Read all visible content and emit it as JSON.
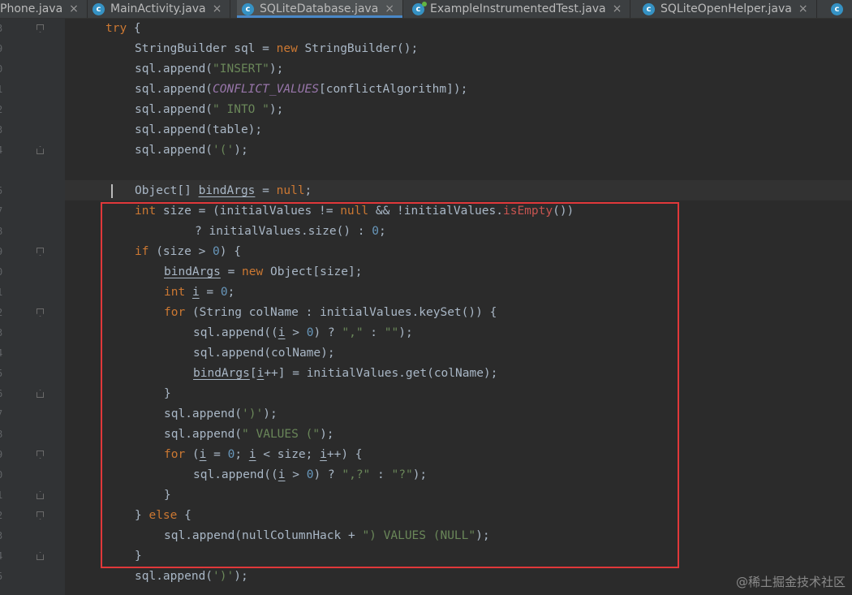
{
  "tabs": [
    {
      "label": "Phone.java",
      "icon": "none",
      "active": false
    },
    {
      "label": "MainActivity.java",
      "icon": "class-icon",
      "active": false
    },
    {
      "label": "SQLiteDatabase.java",
      "icon": "class-icon",
      "active": true
    },
    {
      "label": "ExampleInstrumentedTest.java",
      "icon": "test-class-icon",
      "active": false
    },
    {
      "label": "SQLiteOpenHelper.java",
      "icon": "class-icon",
      "active": false
    },
    {
      "label": "",
      "icon": "class-icon",
      "active": false
    }
  ],
  "tab_close_glyph": "×",
  "line_numbers": [
    "3",
    "9",
    "0",
    "1",
    "2",
    "3",
    "4",
    "",
    "5",
    "7",
    "8",
    "9",
    "0",
    "1",
    "2",
    "3",
    "4",
    "5",
    "6",
    "7",
    "8",
    "9",
    "0",
    "1",
    "2",
    "3",
    "4",
    "5"
  ],
  "code_lines": [
    [
      [
        "kw",
        "try"
      ],
      [
        "p",
        " {"
      ]
    ],
    [
      [
        "p",
        "StringBuilder sql = "
      ],
      [
        "kw",
        "new"
      ],
      [
        "p",
        " StringBuilder();"
      ]
    ],
    [
      [
        "p",
        "sql.append("
      ],
      [
        "str",
        "\"INSERT\""
      ],
      [
        "p",
        ");"
      ]
    ],
    [
      [
        "p",
        "sql.append("
      ],
      [
        "const",
        "CONFLICT_VALUES"
      ],
      [
        "p",
        "[conflictAlgorithm]);"
      ]
    ],
    [
      [
        "p",
        "sql.append("
      ],
      [
        "str",
        "\" INTO \""
      ],
      [
        "p",
        ");"
      ]
    ],
    [
      [
        "p",
        "sql.append(table);"
      ]
    ],
    [
      [
        "p",
        "sql.append("
      ],
      [
        "str",
        "'('"
      ],
      [
        "p",
        ");"
      ]
    ],
    [],
    [
      [
        "p",
        "Object[] "
      ],
      [
        "ul",
        "bindArgs"
      ],
      [
        "p",
        " = "
      ],
      [
        "kw",
        "null"
      ],
      [
        "p",
        ";"
      ]
    ],
    [
      [
        "kw",
        "int"
      ],
      [
        "p",
        " size = (initialValues != "
      ],
      [
        "kw",
        "null"
      ],
      [
        "p",
        " && !initialValues."
      ],
      [
        "static",
        "isEmpty"
      ],
      [
        "p",
        "())"
      ]
    ],
    [
      [
        "p",
        "? initialValues.size() : "
      ],
      [
        "num",
        "0"
      ],
      [
        "p",
        ";"
      ]
    ],
    [
      [
        "kw",
        "if"
      ],
      [
        "p",
        " (size > "
      ],
      [
        "num",
        "0"
      ],
      [
        "p",
        ") {"
      ]
    ],
    [
      [
        "ul",
        "bindArgs"
      ],
      [
        "p",
        " = "
      ],
      [
        "kw",
        "new"
      ],
      [
        "p",
        " Object[size];"
      ]
    ],
    [
      [
        "kw",
        "int"
      ],
      [
        "p",
        " "
      ],
      [
        "ul",
        "i"
      ],
      [
        "p",
        " = "
      ],
      [
        "num",
        "0"
      ],
      [
        "p",
        ";"
      ]
    ],
    [
      [
        "kw",
        "for"
      ],
      [
        "p",
        " (String colName : initialValues.keySet()) {"
      ]
    ],
    [
      [
        "p",
        "sql.append(("
      ],
      [
        "ul",
        "i"
      ],
      [
        "p",
        " > "
      ],
      [
        "num",
        "0"
      ],
      [
        "p",
        ") ? "
      ],
      [
        "str",
        "\",\""
      ],
      [
        "p",
        " : "
      ],
      [
        "str",
        "\"\""
      ],
      [
        "p",
        ");"
      ]
    ],
    [
      [
        "p",
        "sql.append(colName);"
      ]
    ],
    [
      [
        "ul",
        "bindArgs"
      ],
      [
        "p",
        "["
      ],
      [
        "ul",
        "i"
      ],
      [
        "p",
        "++] = initialValues.get(colName);"
      ]
    ],
    [
      [
        "p",
        "}"
      ]
    ],
    [
      [
        "p",
        "sql.append("
      ],
      [
        "str",
        "')'"
      ],
      [
        "p",
        ");"
      ]
    ],
    [
      [
        "p",
        "sql.append("
      ],
      [
        "str",
        "\" VALUES (\""
      ],
      [
        "p",
        ");"
      ]
    ],
    [
      [
        "kw",
        "for"
      ],
      [
        "p",
        " ("
      ],
      [
        "ul",
        "i"
      ],
      [
        "p",
        " = "
      ],
      [
        "num",
        "0"
      ],
      [
        "p",
        "; "
      ],
      [
        "ul",
        "i"
      ],
      [
        "p",
        " < size; "
      ],
      [
        "ul",
        "i"
      ],
      [
        "p",
        "++) {"
      ]
    ],
    [
      [
        "p",
        "sql.append(("
      ],
      [
        "ul",
        "i"
      ],
      [
        "p",
        " > "
      ],
      [
        "num",
        "0"
      ],
      [
        "p",
        ") ? "
      ],
      [
        "str",
        "\",?\""
      ],
      [
        "p",
        " : "
      ],
      [
        "str",
        "\"?\""
      ],
      [
        "p",
        ");"
      ]
    ],
    [
      [
        "p",
        "}"
      ]
    ],
    [
      [
        "p",
        "} "
      ],
      [
        "kw",
        "else"
      ],
      [
        "p",
        " {"
      ]
    ],
    [
      [
        "p",
        "sql.append(nullColumnHack + "
      ],
      [
        "str",
        "\") VALUES (NULL\""
      ],
      [
        "p",
        ");"
      ]
    ],
    [
      [
        "p",
        "}"
      ]
    ],
    [
      [
        "p",
        "sql.append("
      ],
      [
        "str",
        "')'"
      ],
      [
        "p",
        ");"
      ]
    ]
  ],
  "watermark": "@稀土掘金技术社区",
  "colors": {
    "background": "#2b2b2b",
    "keyword": "#cc7832",
    "string": "#6a8759",
    "number": "#6897bb",
    "constant": "#9876aa",
    "highlight_box": "#e0383a"
  }
}
